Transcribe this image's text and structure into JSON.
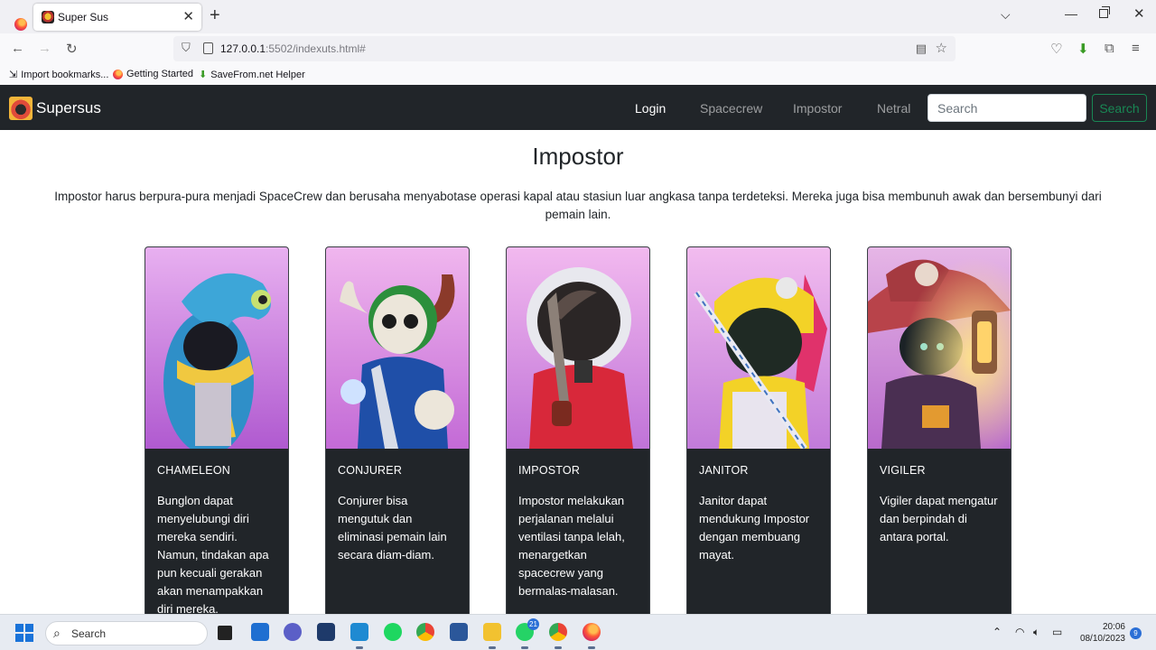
{
  "browser": {
    "tab_title": "Super Sus",
    "url_host": "127.0.0.1",
    "url_rest": ":5502/indexuts.html#",
    "bookmarks": [
      "Import bookmarks...",
      "Getting Started",
      "SaveFrom.net Helper"
    ]
  },
  "site": {
    "brand": "Supersus",
    "nav": [
      "Login",
      "Spacecrew",
      "Impostor",
      "Netral"
    ],
    "search_placeholder": "Search",
    "search_button": "Search"
  },
  "section": {
    "title": "Impostor",
    "description": "Impostor harus berpura-pura menjadi SpaceCrew dan berusaha menyabotase operasi kapal atau stasiun luar angkasa tanpa terdeteksi. Mereka juga bisa membunuh awak dan bersembunyi dari pemain lain."
  },
  "cards": [
    {
      "title": "CHAMELEON",
      "text": "Bunglon dapat menyelubungi diri mereka sendiri. Namun, tindakan apa pun kecuali gerakan akan menampakkan diri mereka."
    },
    {
      "title": "CONJURER",
      "text": "Conjurer bisa mengutuk dan eliminasi pemain lain secara diam-diam."
    },
    {
      "title": "IMPOSTOR",
      "text": "Impostor melakukan perjalanan melalui ventilasi tanpa lelah, menargetkan spacecrew yang bermalas-malasan."
    },
    {
      "title": "JANITOR",
      "text": "Janitor dapat mendukung Impostor dengan membuang mayat."
    },
    {
      "title": "VIGILER",
      "text": "Vigiler dapat mengatur dan berpindah di antara portal."
    }
  ],
  "taskbar": {
    "search_label": "Search",
    "whatsapp_badge": "21",
    "time": "20:06",
    "date": "08/10/2023",
    "notifications": "9"
  },
  "colors": {
    "navbar_bg": "#212529",
    "search_button": "#198754",
    "card_bg": "#212529"
  }
}
